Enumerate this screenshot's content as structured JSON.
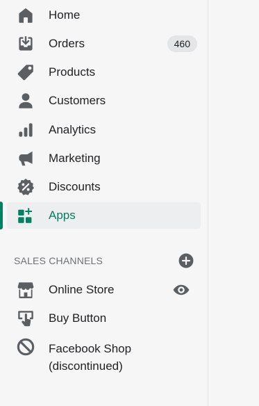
{
  "nav": {
    "items": [
      {
        "label": "Home",
        "icon": "home-icon"
      },
      {
        "label": "Orders",
        "icon": "orders-icon",
        "badge": "460"
      },
      {
        "label": "Products",
        "icon": "tag-icon"
      },
      {
        "label": "Customers",
        "icon": "person-icon"
      },
      {
        "label": "Analytics",
        "icon": "bar-chart-icon"
      },
      {
        "label": "Marketing",
        "icon": "megaphone-icon"
      },
      {
        "label": "Discounts",
        "icon": "discount-icon"
      },
      {
        "label": "Apps",
        "icon": "apps-icon",
        "active": true
      }
    ]
  },
  "sales_channels": {
    "title": "SALES CHANNELS",
    "add_icon": "plus-circle-icon",
    "items": [
      {
        "label": "Online Store",
        "icon": "store-icon",
        "action_icon": "eye-icon"
      },
      {
        "label": "Buy Button",
        "icon": "buy-button-icon"
      },
      {
        "label_line1": "Facebook Shop",
        "label_line2": "(discontinued)",
        "icon": "prohibited-icon"
      }
    ]
  },
  "colors": {
    "accent": "#008060",
    "active_text": "#007f5f",
    "icon": "#5c5f62",
    "text": "#202223",
    "muted": "#6d7175"
  }
}
